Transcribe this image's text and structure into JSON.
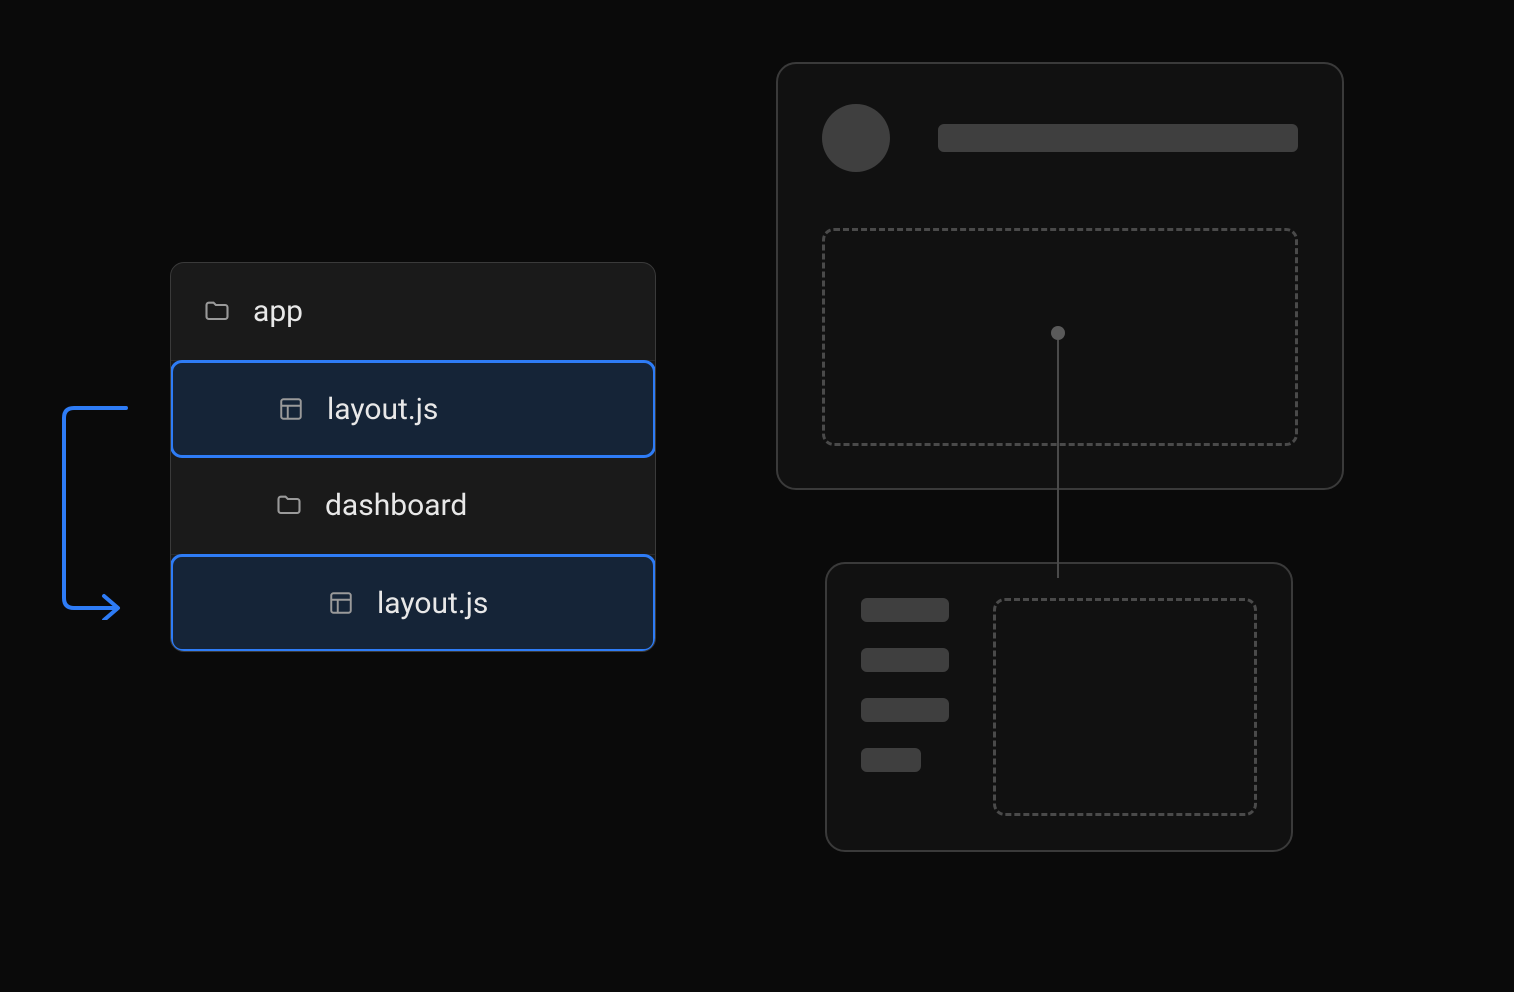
{
  "tree": {
    "root": "app",
    "items": [
      {
        "name": "layout.js",
        "kind": "layout-file",
        "highlighted": true,
        "depth": 1
      },
      {
        "name": "dashboard",
        "kind": "folder",
        "highlighted": false,
        "depth": 1
      },
      {
        "name": "layout.js",
        "kind": "layout-file",
        "highlighted": true,
        "depth": 2
      }
    ]
  },
  "colors": {
    "highlight_border": "#2e7cf6",
    "highlight_fill": "#152437",
    "panel_border": "#3a3a3a",
    "placeholder": "#3f3f3f",
    "dashed": "#4a4a4a",
    "background": "#0a0a0a"
  }
}
